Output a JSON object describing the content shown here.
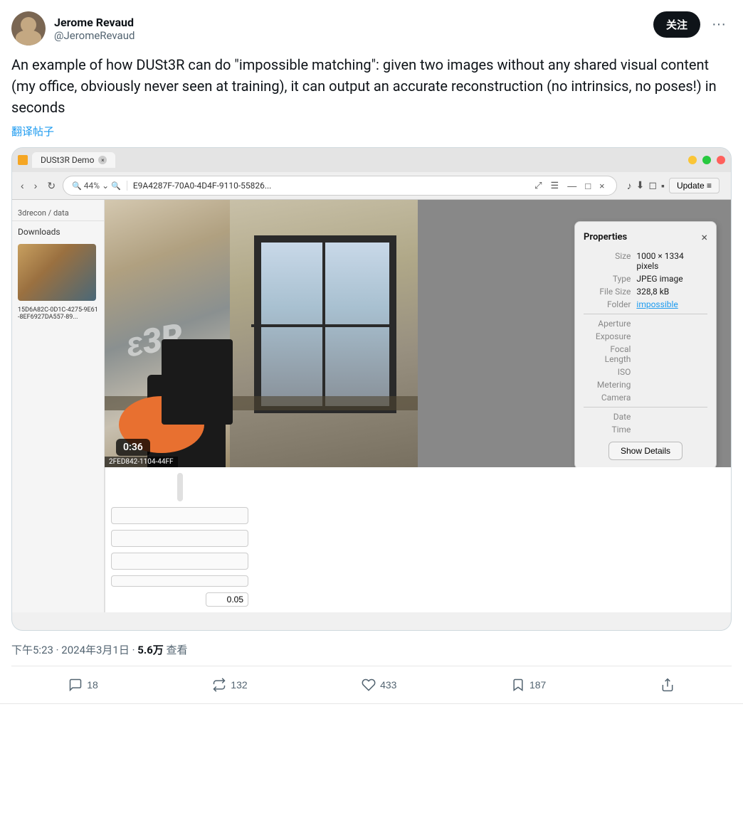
{
  "user": {
    "name": "Jerome Revaud",
    "handle": "@JeromeRevaud",
    "follow_label": "关注"
  },
  "tweet": {
    "text": "An example of how DUSt3R can do \"impossible matching\": given two images without any shared visual content (my office, obviously never seen at training), it can output an accurate reconstruction (no intrinsics, no poses!) in seconds",
    "translate_label": "翻译帖子",
    "timestamp": "下午5:23 · 2024年3月1日 · ",
    "views_prefix": "",
    "views": "5.6万",
    "views_suffix": " 查看"
  },
  "browser": {
    "tab_label": "DUSt3R Demo",
    "zoom": "44%",
    "address": "E9A4287F-70A0-4D4F-9110-55826...",
    "breadcrumb": "3drecon / data",
    "sidebar_item": "Downloads",
    "sidebar_filename": "15D6A82C-0D1C-4275-9E61-8EF6927DA557-89...",
    "bottom_filename": "2FED842-1104-44FF",
    "update_label": "Update ≡",
    "timer": "0:36"
  },
  "properties": {
    "title": "Properties",
    "size_label": "Size",
    "size_value": "1000 × 1334 pixels",
    "type_label": "Type",
    "type_value": "JPEG image",
    "filesize_label": "File Size",
    "filesize_value": "328,8 kB",
    "folder_label": "Folder",
    "folder_value": "impossible",
    "aperture_label": "Aperture",
    "exposure_label": "Exposure",
    "focal_label": "Focal Length",
    "iso_label": "ISO",
    "metering_label": "Metering",
    "camera_label": "Camera",
    "date_label": "Date",
    "time_label": "Time",
    "show_details_label": "Show Details"
  },
  "watermark": "ɛ3R",
  "right_panel": {
    "value": "0.05"
  },
  "actions": {
    "comment_count": "18",
    "retweet_count": "132",
    "like_count": "433",
    "bookmark_count": "187"
  }
}
